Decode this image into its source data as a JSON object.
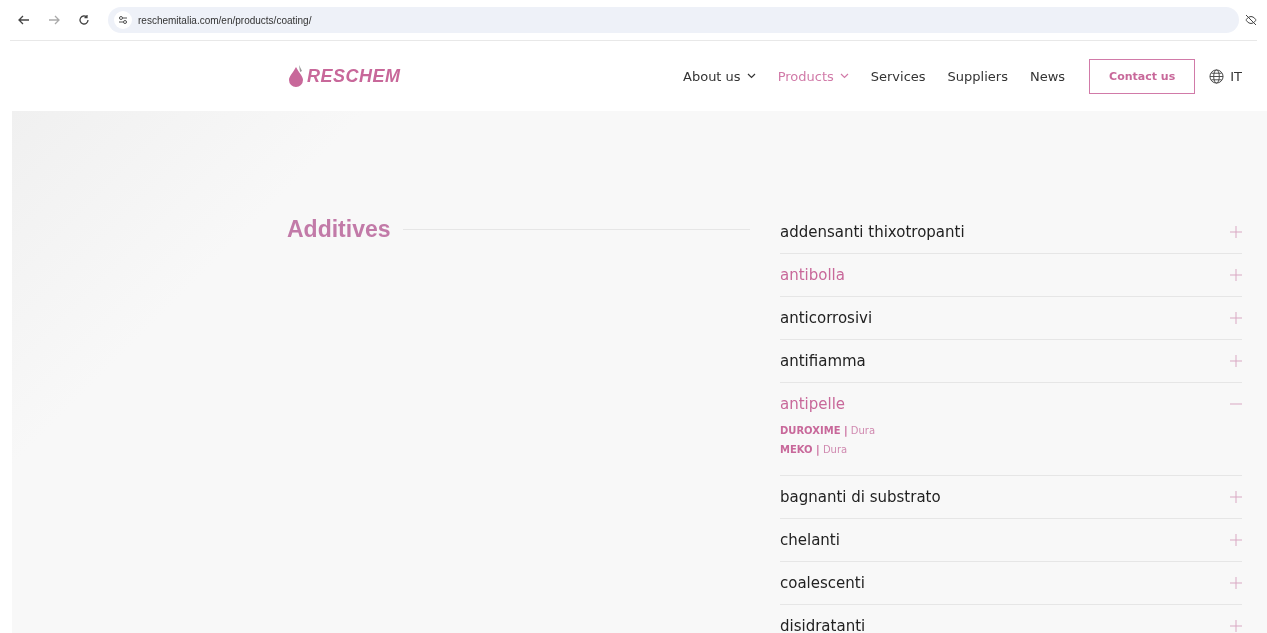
{
  "browser": {
    "url": "reschemitalia.com/en/products/coating/"
  },
  "header": {
    "logo": "RESCHEM",
    "nav": [
      {
        "label": "About us",
        "has_menu": true,
        "selected": false
      },
      {
        "label": "Products",
        "has_menu": true,
        "selected": true
      },
      {
        "label": "Services",
        "has_menu": false,
        "selected": false
      },
      {
        "label": "Suppliers",
        "has_menu": false,
        "selected": false
      },
      {
        "label": "News",
        "has_menu": false,
        "selected": false
      }
    ],
    "contact_button": "Contact us",
    "language": "IT"
  },
  "section": {
    "title": "Additives",
    "categories": [
      {
        "label": "addensanti thixotropanti",
        "highlighted": false,
        "expanded": false
      },
      {
        "label": "antibolla",
        "highlighted": true,
        "expanded": false
      },
      {
        "label": "anticorrosivi",
        "highlighted": false,
        "expanded": false
      },
      {
        "label": "antifiamma",
        "highlighted": false,
        "expanded": false
      },
      {
        "label": "antipelle",
        "highlighted": true,
        "expanded": true,
        "products": [
          "**DUROXIME |** Dura",
          "**MEKO |** Dura"
        ]
      },
      {
        "label": "bagnanti di substrato",
        "highlighted": false,
        "expanded": false
      },
      {
        "label": "chelanti",
        "highlighted": false,
        "expanded": false
      },
      {
        "label": "coalescenti",
        "highlighted": false,
        "expanded": false
      },
      {
        "label": "disidratanti",
        "highlighted": false,
        "expanded": false
      }
    ]
  }
}
